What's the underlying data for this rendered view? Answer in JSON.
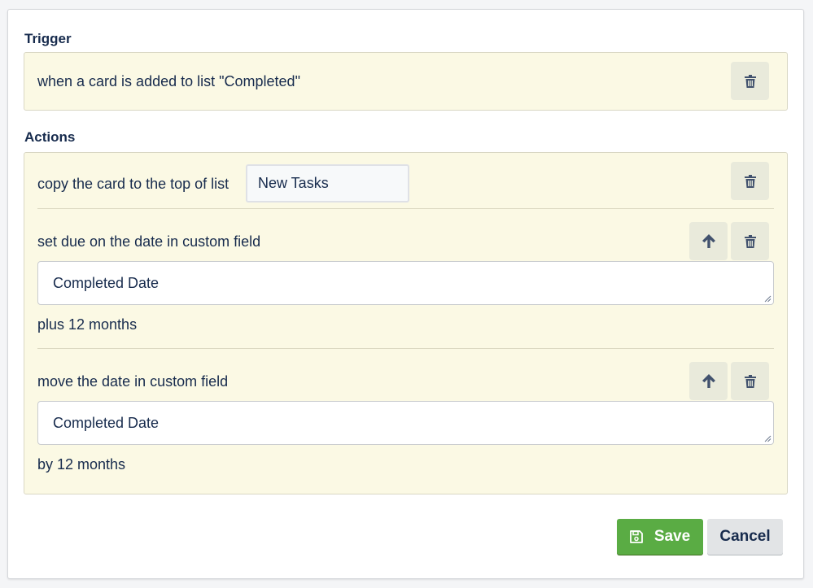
{
  "trigger": {
    "title": "Trigger",
    "text": "when a card is added to list \"Completed\""
  },
  "actions": {
    "title": "Actions",
    "items": [
      {
        "text": "copy the card to the top of list",
        "list_value": "New Tasks"
      },
      {
        "text": "set due on the date in custom field",
        "field_value": "Completed Date",
        "suffix": "plus 12 months"
      },
      {
        "text": "move the date in custom field",
        "field_value": "Completed Date",
        "suffix": "by 12 months"
      }
    ]
  },
  "buttons": {
    "save_label": "Save",
    "cancel_label": "Cancel"
  },
  "icons": {
    "delete": "trash-icon",
    "move_up": "arrow-up-icon",
    "save": "floppy-disk-icon"
  },
  "colors": {
    "panel_bg": "#fbf9e4",
    "save_button": "#5aac44",
    "cancel_button": "#e2e4e6",
    "text": "#172b4d"
  }
}
